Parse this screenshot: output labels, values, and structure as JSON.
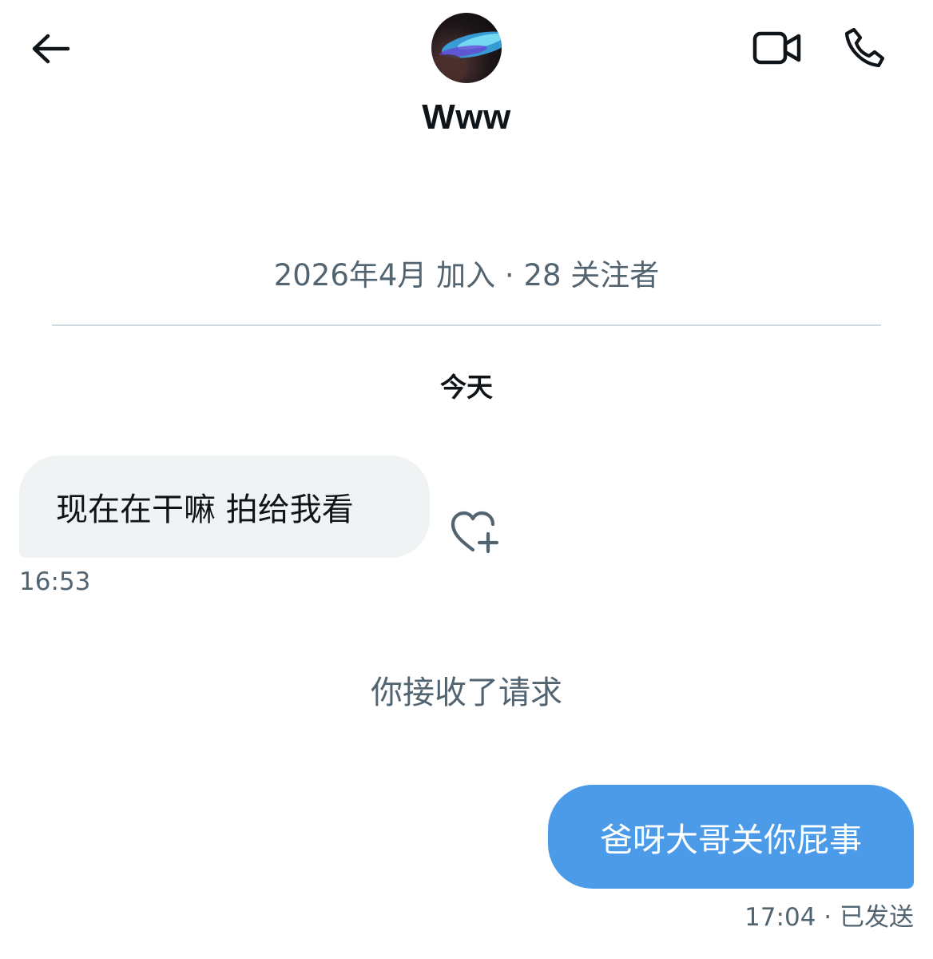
{
  "header": {
    "name": "Www",
    "back_icon": "arrow-left-icon",
    "video_icon": "video-camera-icon",
    "call_icon": "phone-icon"
  },
  "profile": {
    "meta": "2026年4月 加入 · 28 关注者"
  },
  "conversation": {
    "date_separator": "今天",
    "messages": [
      {
        "direction": "incoming",
        "text": "现在在干嘛 拍给我看",
        "time": "16:53",
        "reaction_icon": "heart-plus-icon"
      },
      {
        "direction": "system",
        "text": "你接收了请求"
      },
      {
        "direction": "outgoing",
        "text": "爸呀大哥关你屁事",
        "time": "17:04",
        "status": "已发送"
      }
    ]
  },
  "colors": {
    "outgoing_bubble": "#4b9be9",
    "incoming_bubble": "#eff3f4",
    "secondary_text": "#536471",
    "primary_text": "#0f1419"
  }
}
